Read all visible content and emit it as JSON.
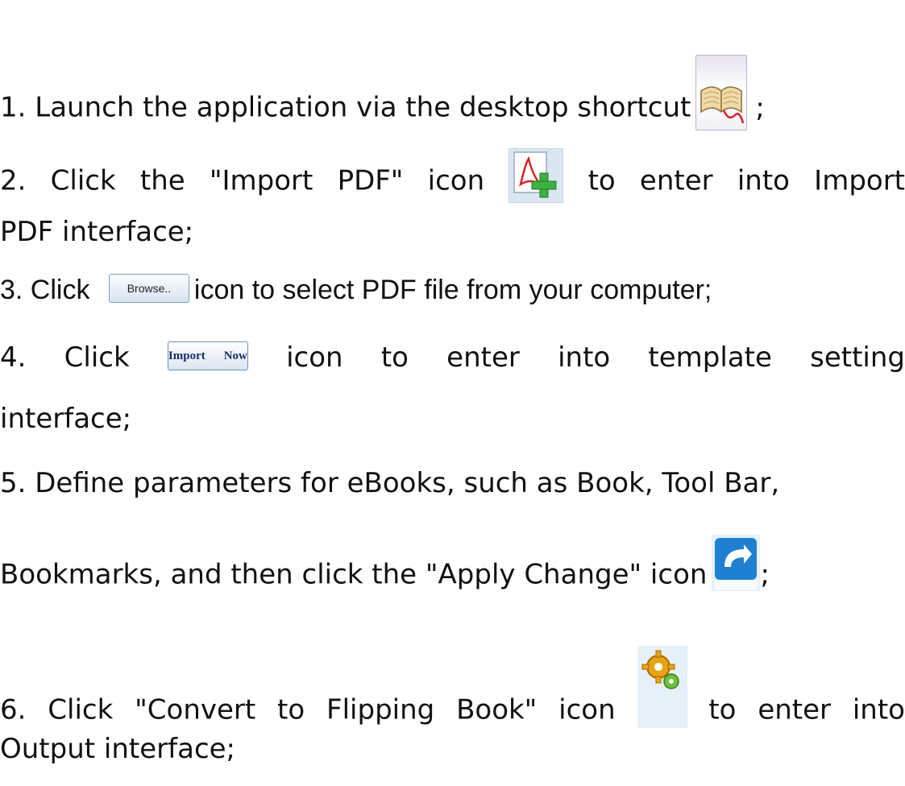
{
  "steps": [
    {
      "before": "1. Launch the application via the desktop shortcut",
      "icon": "book-icon",
      "after": ";"
    },
    {
      "before": "2. Click the \"Import PDF\" icon",
      "icon": "import-pdf-icon",
      "after": "to enter into Import",
      "continuation": "PDF interface;"
    },
    {
      "before": "3. Click",
      "button_label": "Browse..",
      "after": "icon to select PDF file from your computer;"
    },
    {
      "before": "4. Click",
      "button_label": "Import Now",
      "after": "icon to enter into template setting",
      "continuation": "interface;"
    },
    {
      "line1": "5. Define parameters for eBooks, such as Book, Tool Bar,",
      "before": "Bookmarks, and then click the \"Apply Change\" icon",
      "icon": "apply-change-icon",
      "after": ";"
    },
    {
      "before": "6. Click \"Convert to Flipping Book\" icon",
      "icon": "convert-icon",
      "after": "to enter into",
      "continuation": "Output interface;"
    }
  ],
  "colors": {
    "text": "#111111",
    "button_border": "#7f9db9",
    "import_now_text": "#1a2e66",
    "pdf_red": "#d8222a",
    "plus_green": "#3cb043",
    "apply_blue": "#1f7fd0",
    "gear_orange": "#e8a317"
  }
}
